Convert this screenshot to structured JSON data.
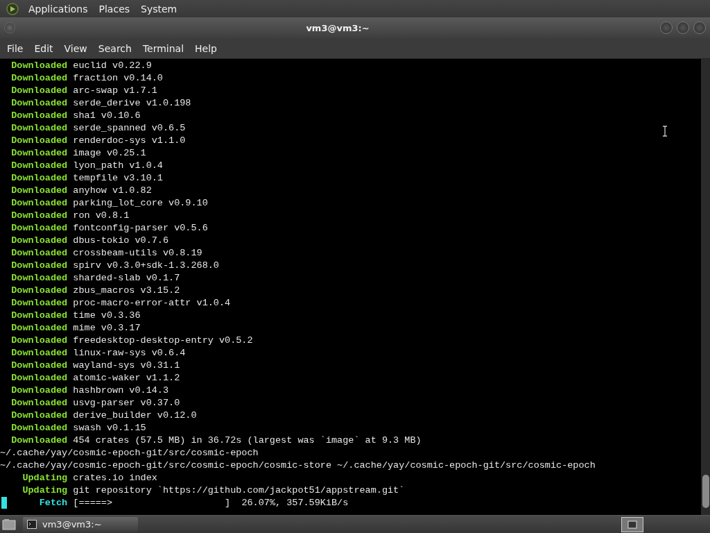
{
  "top_panel": {
    "menus": [
      "Applications",
      "Places",
      "System"
    ]
  },
  "window": {
    "title": "vm3@vm3:~"
  },
  "menubar": [
    "File",
    "Edit",
    "View",
    "Search",
    "Terminal",
    "Help"
  ],
  "terminal": {
    "lines": [
      {
        "kind": "status",
        "label": "Downloaded",
        "color": "#8ae234",
        "text": "euclid v0.22.9"
      },
      {
        "kind": "status",
        "label": "Downloaded",
        "color": "#8ae234",
        "text": "fraction v0.14.0"
      },
      {
        "kind": "status",
        "label": "Downloaded",
        "color": "#8ae234",
        "text": "arc-swap v1.7.1"
      },
      {
        "kind": "status",
        "label": "Downloaded",
        "color": "#8ae234",
        "text": "serde_derive v1.0.198"
      },
      {
        "kind": "status",
        "label": "Downloaded",
        "color": "#8ae234",
        "text": "sha1 v0.10.6"
      },
      {
        "kind": "status",
        "label": "Downloaded",
        "color": "#8ae234",
        "text": "serde_spanned v0.6.5"
      },
      {
        "kind": "status",
        "label": "Downloaded",
        "color": "#8ae234",
        "text": "renderdoc-sys v1.1.0"
      },
      {
        "kind": "status",
        "label": "Downloaded",
        "color": "#8ae234",
        "text": "image v0.25.1"
      },
      {
        "kind": "status",
        "label": "Downloaded",
        "color": "#8ae234",
        "text": "lyon_path v1.0.4"
      },
      {
        "kind": "status",
        "label": "Downloaded",
        "color": "#8ae234",
        "text": "tempfile v3.10.1"
      },
      {
        "kind": "status",
        "label": "Downloaded",
        "color": "#8ae234",
        "text": "anyhow v1.0.82"
      },
      {
        "kind": "status",
        "label": "Downloaded",
        "color": "#8ae234",
        "text": "parking_lot_core v0.9.10"
      },
      {
        "kind": "status",
        "label": "Downloaded",
        "color": "#8ae234",
        "text": "ron v0.8.1"
      },
      {
        "kind": "status",
        "label": "Downloaded",
        "color": "#8ae234",
        "text": "fontconfig-parser v0.5.6"
      },
      {
        "kind": "status",
        "label": "Downloaded",
        "color": "#8ae234",
        "text": "dbus-tokio v0.7.6"
      },
      {
        "kind": "status",
        "label": "Downloaded",
        "color": "#8ae234",
        "text": "crossbeam-utils v0.8.19"
      },
      {
        "kind": "status",
        "label": "Downloaded",
        "color": "#8ae234",
        "text": "spirv v0.3.0+sdk-1.3.268.0"
      },
      {
        "kind": "status",
        "label": "Downloaded",
        "color": "#8ae234",
        "text": "sharded-slab v0.1.7"
      },
      {
        "kind": "status",
        "label": "Downloaded",
        "color": "#8ae234",
        "text": "zbus_macros v3.15.2"
      },
      {
        "kind": "status",
        "label": "Downloaded",
        "color": "#8ae234",
        "text": "proc-macro-error-attr v1.0.4"
      },
      {
        "kind": "status",
        "label": "Downloaded",
        "color": "#8ae234",
        "text": "time v0.3.36"
      },
      {
        "kind": "status",
        "label": "Downloaded",
        "color": "#8ae234",
        "text": "mime v0.3.17"
      },
      {
        "kind": "status",
        "label": "Downloaded",
        "color": "#8ae234",
        "text": "freedesktop-desktop-entry v0.5.2"
      },
      {
        "kind": "status",
        "label": "Downloaded",
        "color": "#8ae234",
        "text": "linux-raw-sys v0.6.4"
      },
      {
        "kind": "status",
        "label": "Downloaded",
        "color": "#8ae234",
        "text": "wayland-sys v0.31.1"
      },
      {
        "kind": "status",
        "label": "Downloaded",
        "color": "#8ae234",
        "text": "atomic-waker v1.1.2"
      },
      {
        "kind": "status",
        "label": "Downloaded",
        "color": "#8ae234",
        "text": "hashbrown v0.14.3"
      },
      {
        "kind": "status",
        "label": "Downloaded",
        "color": "#8ae234",
        "text": "usvg-parser v0.37.0"
      },
      {
        "kind": "status",
        "label": "Downloaded",
        "color": "#8ae234",
        "text": "derive_builder v0.12.0"
      },
      {
        "kind": "status",
        "label": "Downloaded",
        "color": "#8ae234",
        "text": "swash v0.1.15"
      },
      {
        "kind": "status",
        "label": "Downloaded",
        "color": "#8ae234",
        "text": "454 crates (57.5 MB) in 36.72s (largest was `image` at 9.3 MB)"
      },
      {
        "kind": "plain",
        "text": "~/.cache/yay/cosmic-epoch-git/src/cosmic-epoch"
      },
      {
        "kind": "plain",
        "text": "~/.cache/yay/cosmic-epoch-git/src/cosmic-epoch/cosmic-store ~/.cache/yay/cosmic-epoch-git/src/cosmic-epoch"
      },
      {
        "kind": "status",
        "label": "Updating",
        "color": "#8ae234",
        "text": "crates.io index"
      },
      {
        "kind": "status",
        "label": "Updating",
        "color": "#8ae234",
        "text": "git repository `https://github.com/jackpot51/appstream.git`"
      },
      {
        "kind": "status",
        "label": "Fetch",
        "color": "#34e2e2",
        "text": "[=====>                    ]  26.07%, 357.59KiB/s",
        "cursor": true
      }
    ]
  },
  "taskbar": {
    "tasks": [
      {
        "label": "vm3@vm3:~",
        "selected": false
      }
    ]
  }
}
